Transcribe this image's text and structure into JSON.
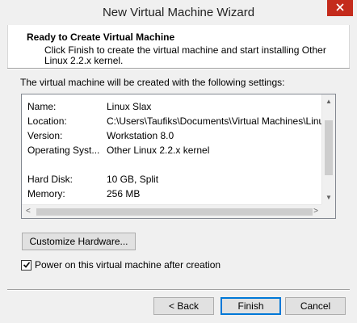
{
  "window": {
    "title": "New Virtual Machine Wizard"
  },
  "header": {
    "title": "Ready to Create Virtual Machine",
    "description": "Click Finish to create the virtual machine and start installing Other Linux 2.2.x kernel."
  },
  "body": {
    "intro": "The virtual machine will be created with the following settings:",
    "settings": [
      {
        "label": "Name:",
        "value": "Linux Slax"
      },
      {
        "label": "Location:",
        "value": "C:\\Users\\Taufiks\\Documents\\Virtual Machines\\Linu"
      },
      {
        "label": "Version:",
        "value": "Workstation 8.0"
      },
      {
        "label": "Operating Syst...",
        "value": "Other Linux 2.2.x kernel"
      },
      {
        "label": "",
        "value": ""
      },
      {
        "label": "Hard Disk:",
        "value": "10 GB, Split"
      },
      {
        "label": "Memory:",
        "value": "256 MB"
      }
    ]
  },
  "buttons": {
    "customize": "Customize Hardware...",
    "back": "< Back",
    "finish": "Finish",
    "cancel": "Cancel"
  },
  "checkbox": {
    "label": "Power on this virtual machine after creation",
    "checked": true
  },
  "icons": {
    "close": "close-icon",
    "check": "checkmark-icon",
    "scroll_up": "scroll-up-arrow-icon",
    "scroll_down": "scroll-down-arrow-icon",
    "scroll_left": "scroll-left-arrow-icon",
    "scroll_right": "scroll-right-arrow-icon"
  },
  "colors": {
    "close_button": "#c42b1c",
    "default_button_border": "#0078d7"
  }
}
